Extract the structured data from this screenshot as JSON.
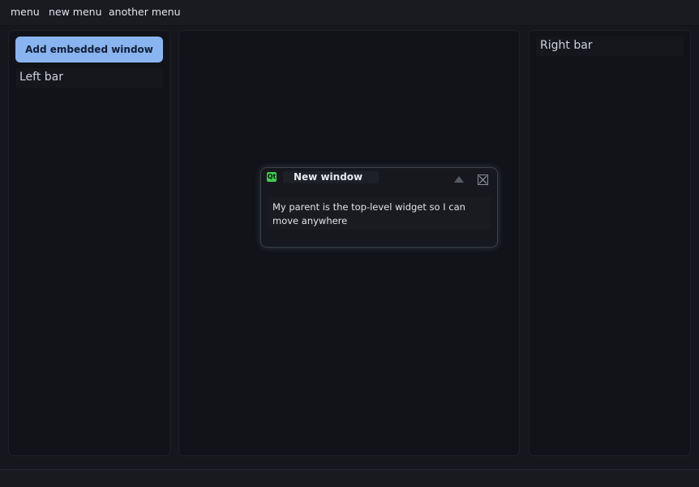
{
  "menubar": {
    "items": [
      {
        "label": "menu"
      },
      {
        "label": "new menu"
      },
      {
        "label": "another menu"
      }
    ]
  },
  "left_panel": {
    "add_button_label": "Add embedded window",
    "label": "Left bar"
  },
  "right_panel": {
    "label": "Right bar"
  },
  "floating_window": {
    "icon": "qt-app-icon",
    "icon_text": "Qt",
    "title": "New window",
    "body_text": "My parent is the top-level widget so I can move anywhere",
    "collapse_icon": "triangle-up-icon",
    "close_icon": "close-icon"
  },
  "colors": {
    "background": "#15171c",
    "accent": "#8ab4f0",
    "qt_green": "#41cd52"
  }
}
